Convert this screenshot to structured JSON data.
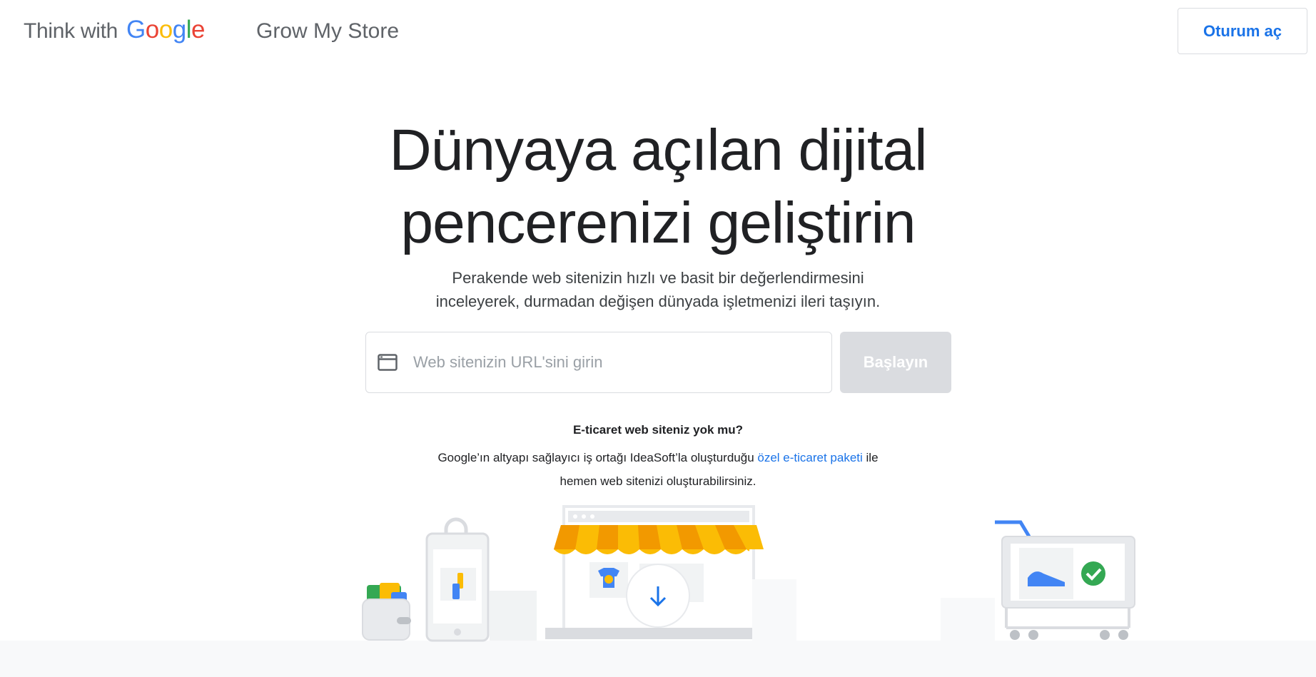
{
  "header": {
    "brand_prefix": "Think with",
    "brand_logo_letters": [
      {
        "char": "G",
        "color": "#4285F4"
      },
      {
        "char": "o",
        "color": "#EA4335"
      },
      {
        "char": "o",
        "color": "#FBBC05"
      },
      {
        "char": "g",
        "color": "#4285F4"
      },
      {
        "char": "l",
        "color": "#34A853"
      },
      {
        "char": "e",
        "color": "#EA4335"
      }
    ],
    "product_title": "Grow My Store",
    "signin_label": "Oturum aç"
  },
  "hero": {
    "title_line1": "Dünyaya açılan dijital",
    "title_line2": "pencerenizi geliştirin",
    "subtitle_line1": "Perakende web sitenizin hızlı ve basit bir değerlendirmesini",
    "subtitle_line2": "inceleyerek, durmadan değişen dünyada işletmenizi ileri taşıyın."
  },
  "form": {
    "icon": "browser-window-icon",
    "url_placeholder": "Web sitenizin URL'sini girin",
    "url_value": "",
    "start_label": "Başlayın"
  },
  "no_site": {
    "question": "E-ticaret web siteniz yok mu?",
    "body_before": "Google’ın altyapı sağlayıcı iş ortağı IdeaSoft’la oluşturduğu ",
    "link_text": "özel e-ticaret paketi",
    "body_after_line1": " ile",
    "body_line2": "hemen web sitenizi oluşturabilirsiniz."
  },
  "illustration": {
    "scroll_icon": "arrow-down-icon"
  },
  "colors": {
    "accent": "#1a73e8",
    "button_disabled": "#dadce0",
    "text_primary": "#202124",
    "text_secondary": "#5f6368"
  }
}
